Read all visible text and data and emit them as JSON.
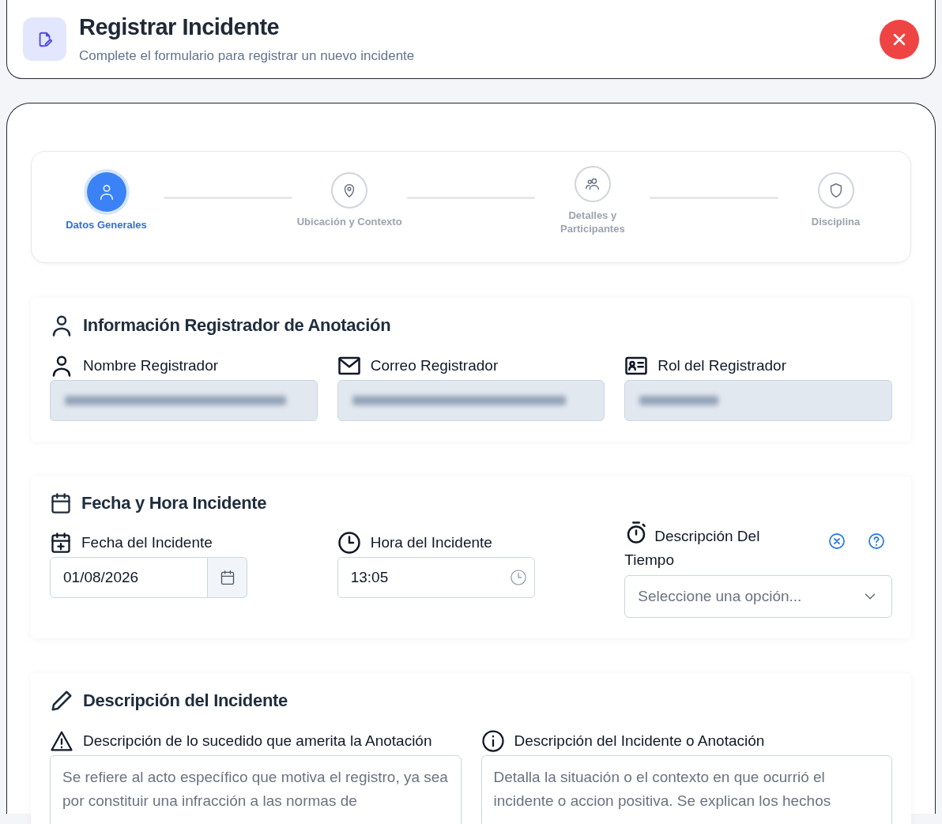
{
  "header": {
    "title": "Registrar Incidente",
    "subtitle": "Complete el formulario para registrar un nuevo incidente"
  },
  "steps": [
    {
      "label": "Datos Generales",
      "selected": true
    },
    {
      "label": "Ubicación y Contexto",
      "selected": false
    },
    {
      "label": "Detalles y Participantes",
      "selected": false
    },
    {
      "label": "Disciplina",
      "selected": false
    }
  ],
  "registrador": {
    "title": "Información Registrador de Anotación",
    "fields": [
      {
        "label": "Nombre Registrador"
      },
      {
        "label": "Correo Registrador"
      },
      {
        "label": "Rol del Registrador"
      }
    ]
  },
  "fecha_hora": {
    "title": "Fecha y Hora Incidente",
    "date": {
      "label": "Fecha del Incidente",
      "value": "01/08/2026"
    },
    "time": {
      "label": "Hora del Incidente",
      "value": "13:05"
    },
    "weather": {
      "label": "Descripción Del Tiempo",
      "placeholder": "Seleccione una opción..."
    }
  },
  "descripcion": {
    "title": "Descripción del Incidente",
    "fields": [
      {
        "label": "Descripción de lo sucedido que amerita la Anotación",
        "placeholder": "Se refiere al acto específico que motiva el registro, ya sea por constituir una infracción a las normas de"
      },
      {
        "label": "Descripción del Incidente o Anotación",
        "placeholder": "Detalla la situación o el contexto en que ocurrió el incidente o accion positiva. Se explican los hechos"
      }
    ]
  }
}
